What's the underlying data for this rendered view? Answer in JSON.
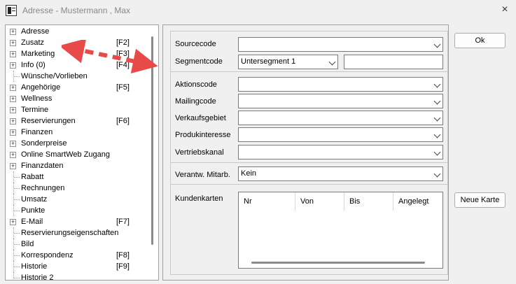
{
  "window": {
    "title": "Adresse - Mustermann , Max",
    "icon": "address-book-icon",
    "close": "×"
  },
  "tree": {
    "items": [
      {
        "label": "Adresse",
        "key": "",
        "expandable": true
      },
      {
        "label": "Zusatz",
        "key": "[F2]",
        "expandable": true
      },
      {
        "label": "Marketing",
        "key": "[F3]",
        "expandable": true
      },
      {
        "label": "Info (0)",
        "key": "[F4]",
        "expandable": true
      },
      {
        "label": "Wünsche/Vorlieben",
        "key": "",
        "expandable": false
      },
      {
        "label": "Angehörige",
        "key": "[F5]",
        "expandable": true
      },
      {
        "label": "Wellness",
        "key": "",
        "expandable": true
      },
      {
        "label": "Termine",
        "key": "",
        "expandable": true
      },
      {
        "label": "Reservierungen",
        "key": "[F6]",
        "expandable": true
      },
      {
        "label": "Finanzen",
        "key": "",
        "expandable": true
      },
      {
        "label": "Sonderpreise",
        "key": "",
        "expandable": true
      },
      {
        "label": "Online SmartWeb Zugang",
        "key": "",
        "expandable": true
      },
      {
        "label": "Finanzdaten",
        "key": "",
        "expandable": true
      },
      {
        "label": "Rabatt",
        "key": "",
        "expandable": false
      },
      {
        "label": "Rechnungen",
        "key": "",
        "expandable": false
      },
      {
        "label": "Umsatz",
        "key": "",
        "expandable": false
      },
      {
        "label": "Punkte",
        "key": "",
        "expandable": false
      },
      {
        "label": "E-Mail",
        "key": "[F7]",
        "expandable": true
      },
      {
        "label": "Reservierungseigenschaften",
        "key": "",
        "expandable": false
      },
      {
        "label": "Bild",
        "key": "",
        "expandable": false
      },
      {
        "label": "Korrespondenz",
        "key": "[F8]",
        "expandable": false
      },
      {
        "label": "Historie",
        "key": "[F9]",
        "expandable": false
      },
      {
        "label": "Historie 2",
        "key": "",
        "expandable": false
      }
    ]
  },
  "form": {
    "sourcecode": {
      "label": "Sourcecode",
      "value": ""
    },
    "segmentcode": {
      "label": "Segmentcode",
      "value": "Untersegment 1",
      "extra": ""
    },
    "aktionscode": {
      "label": "Aktionscode",
      "value": ""
    },
    "mailingcode": {
      "label": "Mailingcode",
      "value": ""
    },
    "verkaufsgebiet": {
      "label": "Verkaufsgebiet",
      "value": ""
    },
    "produkinteresse": {
      "label": "Produkinteresse",
      "value": ""
    },
    "vertriebskanal": {
      "label": "Vertriebskanal",
      "value": ""
    },
    "verantw": {
      "label": "Verantw. Mitarb.",
      "value": "Kein"
    },
    "kundenkarten": {
      "label": "Kundenkarten",
      "columns": [
        "Nr",
        "Von",
        "Bis",
        "Angelegt"
      ]
    }
  },
  "buttons": {
    "ok": "Ok",
    "neue_karte": "Neue Karte"
  },
  "colors": {
    "annotation_arrow": "#e84a4a"
  }
}
